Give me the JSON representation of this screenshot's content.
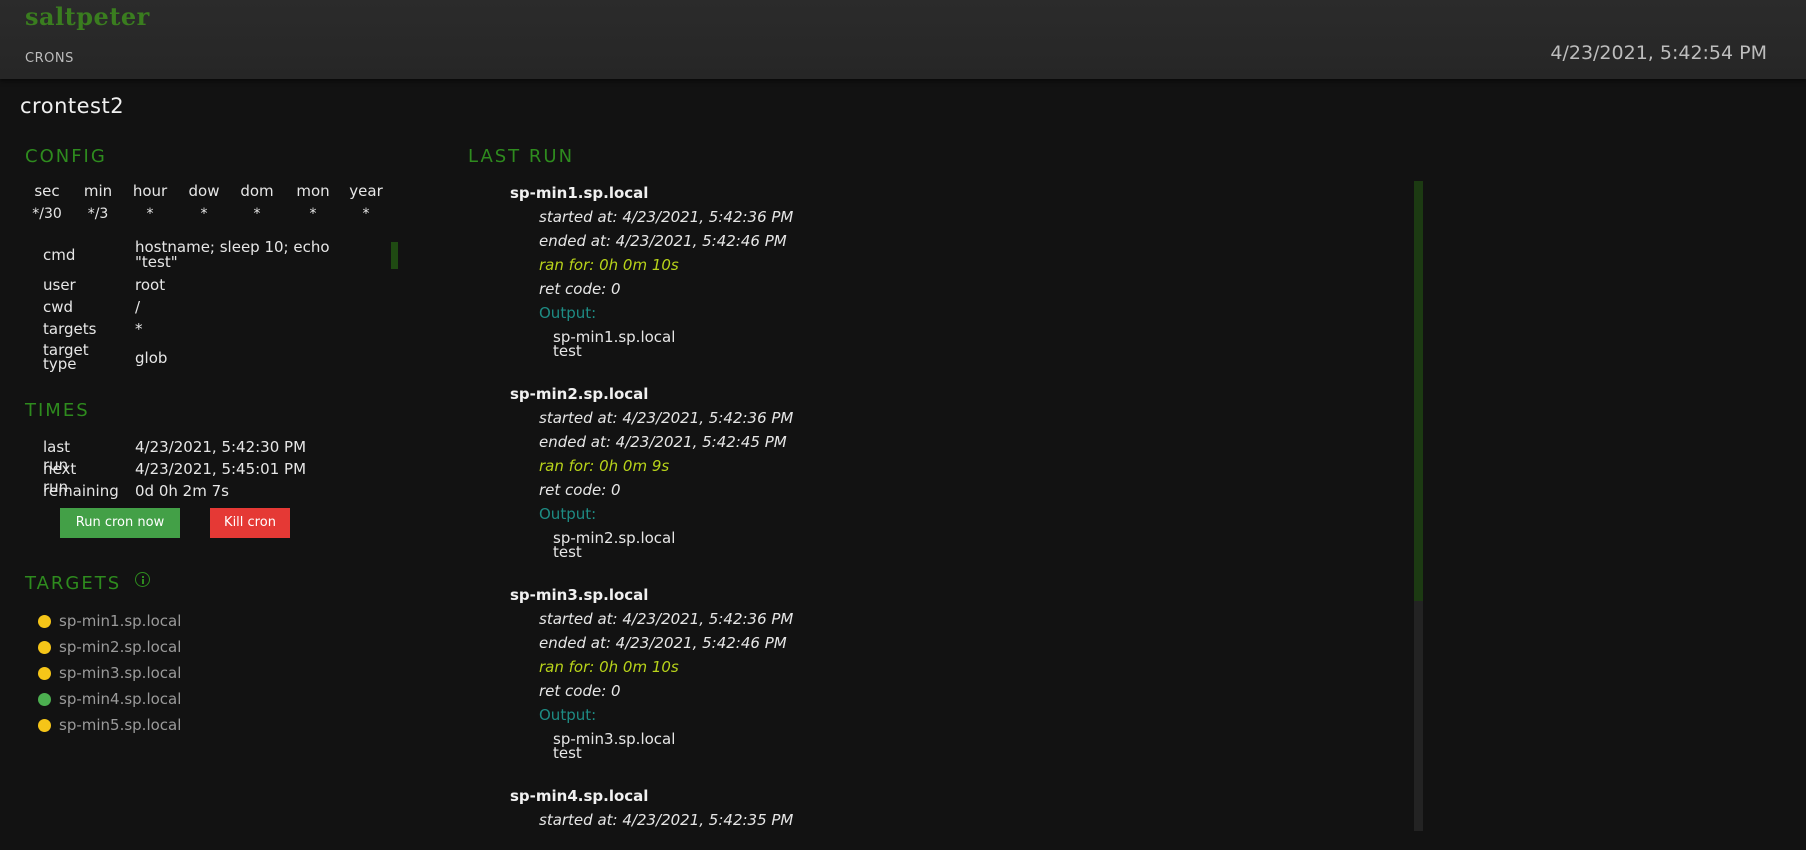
{
  "header": {
    "brand": "saltpeter",
    "nav_crons": "CRONS",
    "clock": "4/23/2021, 5:42:54 PM"
  },
  "page_title": "crontest2",
  "config": {
    "heading": "CONFIG",
    "schedule_headers": [
      "sec",
      "min",
      "hour",
      "dow",
      "dom",
      "mon",
      "year"
    ],
    "schedule_values": [
      "*/30",
      "*/3",
      "*",
      "*",
      "*",
      "*",
      "*"
    ],
    "cmd_label": "cmd",
    "cmd_value_line1": "hostname; sleep 10; echo",
    "cmd_value_line2": "\"test\"",
    "user_label": "user",
    "user_value": "root",
    "cwd_label": "cwd",
    "cwd_value": "/",
    "targets_label": "targets",
    "targets_value": "*",
    "target_type_label_1": "target",
    "target_type_label_2": "type",
    "target_type_value": "glob"
  },
  "times": {
    "heading": "TIMES",
    "last_run_label": "last run",
    "last_run_value": "4/23/2021, 5:42:30 PM",
    "next_run_label": "next run",
    "next_run_value": "4/23/2021, 5:45:01 PM",
    "remaining_label": "remaining",
    "remaining_value": "0d 0h 2m 7s",
    "run_button": "Run cron now",
    "kill_button": "Kill cron"
  },
  "targets": {
    "heading": "TARGETS",
    "items": [
      {
        "name": "sp-min1.sp.local",
        "status_color": "#f5c518"
      },
      {
        "name": "sp-min2.sp.local",
        "status_color": "#f5c518"
      },
      {
        "name": "sp-min3.sp.local",
        "status_color": "#f5c518"
      },
      {
        "name": "sp-min4.sp.local",
        "status_color": "#4caf50"
      },
      {
        "name": "sp-min5.sp.local",
        "status_color": "#f5c518"
      }
    ]
  },
  "last_run": {
    "heading": "LAST RUN",
    "runs": [
      {
        "host": "sp-min1.sp.local",
        "started": "started at: 4/23/2021, 5:42:36 PM",
        "ended": "ended at: 4/23/2021, 5:42:46 PM",
        "ran_for": "ran for: 0h 0m 10s",
        "ret_code": "ret code: 0",
        "output_label": "Output:",
        "output_line1": "sp-min1.sp.local",
        "output_line2": "test"
      },
      {
        "host": "sp-min2.sp.local",
        "started": "started at: 4/23/2021, 5:42:36 PM",
        "ended": "ended at: 4/23/2021, 5:42:45 PM",
        "ran_for": "ran for: 0h 0m 9s",
        "ret_code": "ret code: 0",
        "output_label": "Output:",
        "output_line1": "sp-min2.sp.local",
        "output_line2": "test"
      },
      {
        "host": "sp-min3.sp.local",
        "started": "started at: 4/23/2021, 5:42:36 PM",
        "ended": "ended at: 4/23/2021, 5:42:46 PM",
        "ran_for": "ran for: 0h 0m 10s",
        "ret_code": "ret code: 0",
        "output_label": "Output:",
        "output_line1": "sp-min3.sp.local",
        "output_line2": "test"
      },
      {
        "host": "sp-min4.sp.local",
        "started": "started at: 4/23/2021, 5:42:35 PM"
      }
    ]
  },
  "colors": {
    "brand_green": "#3a7d1f",
    "section_green": "#2e8b1e",
    "ran_for_yellow": "#b8d31a",
    "output_teal": "#1e8c84",
    "run_button": "#43a047",
    "kill_button": "#e53935"
  }
}
